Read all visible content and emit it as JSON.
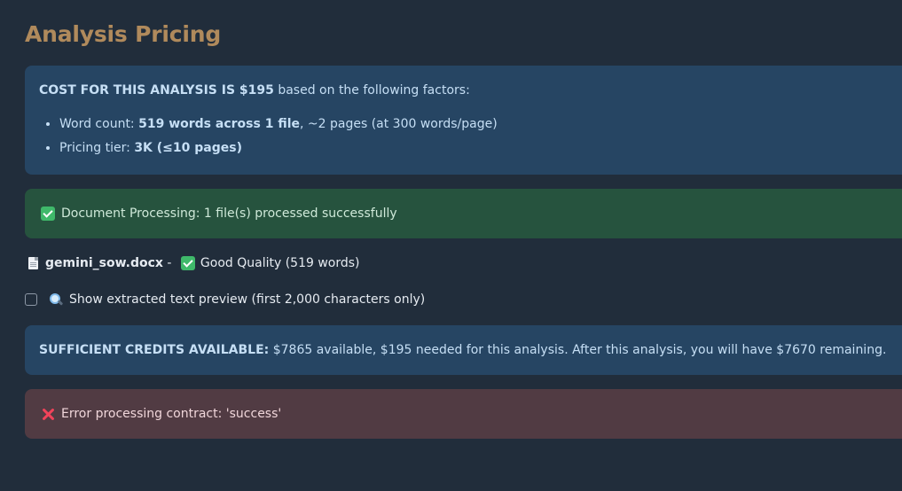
{
  "page": {
    "title": "Analysis Pricing"
  },
  "cost": {
    "headline_bold": "COST FOR THIS ANALYSIS IS $195",
    "headline_rest": " based on the following factors:",
    "factors": [
      {
        "label": "Word count: ",
        "bold": "519 words across 1 file",
        "rest": ", ~2 pages (at 300 words/page)"
      },
      {
        "label": "Pricing tier: ",
        "bold": "3K (≤10 pages)",
        "rest": ""
      }
    ]
  },
  "processing": {
    "icon": "check-mark-icon",
    "message": "Document Processing: 1 file(s) processed successfully"
  },
  "file": {
    "icon": "document-icon",
    "name": "gemini_sow.docx",
    "separator": " - ",
    "quality_icon": "check-mark-icon",
    "quality": "Good Quality (519 words)"
  },
  "preview": {
    "checked": false,
    "icon": "magnifier-icon",
    "label": "Show extracted text preview (first 2,000 characters only)"
  },
  "credits": {
    "bold": "SUFFICIENT CREDITS AVAILABLE:",
    "rest": " $7865 available, $195 needed for this analysis. After this analysis, you will have $7670 remaining."
  },
  "error": {
    "icon": "cross-mark-icon",
    "message": "Error processing contract: 'success'"
  },
  "colors": {
    "background": "#212d3b",
    "title": "#b08a5c",
    "info": "#264563",
    "success": "#26533e",
    "error": "#513b43"
  }
}
